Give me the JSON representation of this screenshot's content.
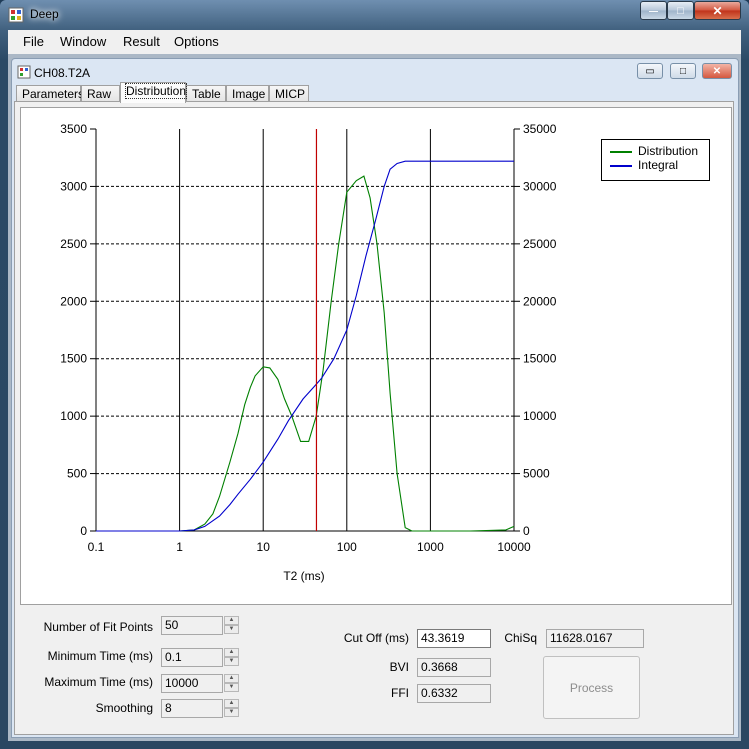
{
  "window": {
    "title": "Deep",
    "minimize": "—",
    "maximize": "□",
    "close": "✕"
  },
  "menu": {
    "file": "File",
    "window": "Window",
    "result": "Result",
    "options": "Options"
  },
  "child_window": {
    "title": "CH08.T2A",
    "minimize": "▭",
    "maximize": "□",
    "close": "✕"
  },
  "tabs": [
    "Parameters",
    "Raw",
    "Distribution",
    "Table",
    "Image",
    "MICP"
  ],
  "active_tab": "Distribution",
  "chart_data": {
    "type": "line",
    "xlabel": "T2 (ms)",
    "xscale": "log",
    "xlim": [
      0.1,
      10000
    ],
    "xticks": [
      "0.1",
      "1",
      "10",
      "100",
      "1000",
      "10000"
    ],
    "ylim_left": [
      0,
      3500
    ],
    "yticks_left": [
      "0",
      "500",
      "1000",
      "1500",
      "2000",
      "2500",
      "3000",
      "3500"
    ],
    "ylim_right": [
      0,
      35000
    ],
    "yticks_right": [
      "0",
      "5000",
      "10000",
      "15000",
      "20000",
      "25000",
      "30000",
      "35000"
    ],
    "cutoff": 43.3619,
    "legend_position": "top-right",
    "series": [
      {
        "name": "Distribution",
        "color": "#008000",
        "axis": "left",
        "x": [
          0.1,
          1,
          1.5,
          2,
          2.5,
          3,
          4,
          5,
          6,
          7,
          8,
          10,
          12,
          15,
          18,
          22,
          28,
          35,
          43,
          52,
          65,
          80,
          100,
          130,
          160,
          190,
          230,
          280,
          330,
          400,
          500,
          600,
          800,
          1000,
          3000,
          8000,
          10000
        ],
        "y": [
          0,
          0,
          10,
          60,
          150,
          300,
          600,
          850,
          1100,
          1250,
          1350,
          1430,
          1420,
          1320,
          1150,
          1000,
          780,
          780,
          1000,
          1400,
          2000,
          2500,
          2950,
          3050,
          3090,
          2900,
          2500,
          1900,
          1200,
          500,
          30,
          0,
          0,
          0,
          0,
          10,
          40
        ]
      },
      {
        "name": "Integral",
        "color": "#0000cc",
        "axis": "right",
        "x": [
          0.1,
          1,
          1.5,
          2,
          3,
          4,
          5,
          7,
          10,
          15,
          20,
          30,
          40,
          50,
          70,
          100,
          130,
          170,
          220,
          280,
          330,
          400,
          500,
          700,
          1000,
          10000
        ],
        "y": [
          0,
          0,
          100,
          400,
          1300,
          2300,
          3200,
          4500,
          6000,
          8000,
          9600,
          11500,
          12500,
          13300,
          15000,
          17500,
          20500,
          24000,
          27000,
          30000,
          31500,
          32000,
          32200,
          32200,
          32200,
          32200
        ]
      }
    ]
  },
  "params": {
    "fit_points_label": "Number of Fit Points",
    "fit_points_value": "50",
    "min_time_label": "Minimum Time (ms)",
    "min_time_value": "0.1",
    "max_time_label": "Maximum Time (ms)",
    "max_time_value": "10000",
    "smoothing_label": "Smoothing",
    "smoothing_value": "8"
  },
  "results": {
    "cutoff_label": "Cut Off (ms)",
    "cutoff_value": "43.3619",
    "bvi_label": "BVI",
    "bvi_value": "0.3668",
    "ffi_label": "FFI",
    "ffi_value": "0.6332",
    "chisq_label": "ChiSq",
    "chisq_value": "11628.0167",
    "process_label": "Process"
  }
}
